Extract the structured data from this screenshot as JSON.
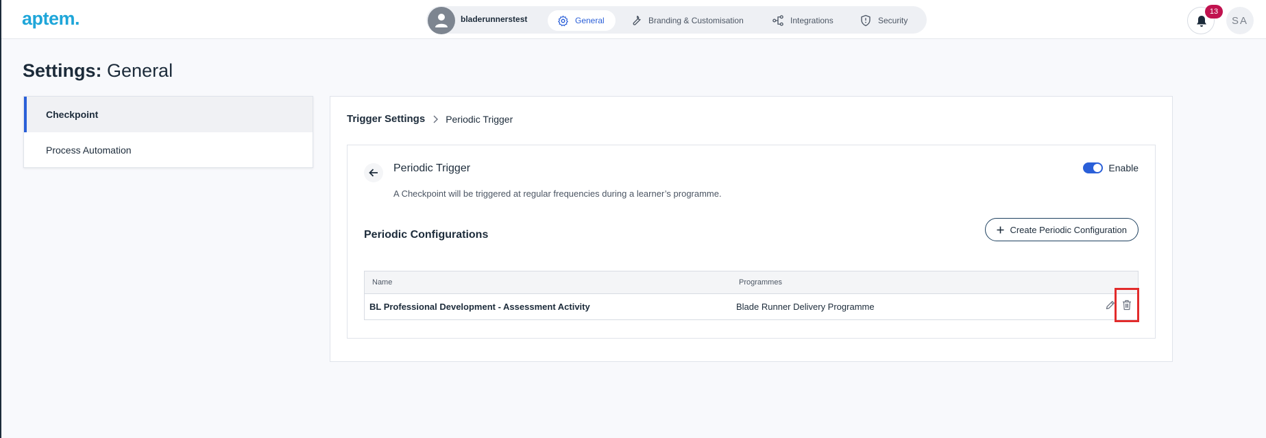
{
  "app": {
    "logo": "aptem.",
    "username": "bladerunnerstest",
    "nav_tabs": [
      {
        "label": "General",
        "icon": "gear-icon",
        "active": true
      },
      {
        "label": "Branding & Customisation",
        "icon": "wrench-icon",
        "active": false
      },
      {
        "label": "Integrations",
        "icon": "integrations-icon",
        "active": false
      },
      {
        "label": "Security",
        "icon": "shield-icon",
        "active": false
      }
    ],
    "notifications_count": "13",
    "user_initials": "SA"
  },
  "page": {
    "title_bold": "Settings:",
    "title_rest": " General"
  },
  "sidebar": {
    "items": [
      {
        "label": "Checkpoint",
        "active": true
      },
      {
        "label": "Process Automation",
        "active": false
      }
    ]
  },
  "breadcrumb": {
    "root": "Trigger Settings",
    "leaf": "Periodic Trigger"
  },
  "trigger": {
    "title": "Periodic Trigger",
    "description": "A Checkpoint will be triggered at regular frequencies during a learner’s programme.",
    "enable_label": "Enable",
    "enabled": true
  },
  "configs": {
    "title": "Periodic Configurations",
    "create_label": "Create Periodic Configuration",
    "columns": [
      "Name",
      "Programmes"
    ],
    "rows": [
      {
        "name": "BL Professional Development - Assessment Activity",
        "programmes": "Blade Runner Delivery Programme"
      }
    ]
  },
  "colors": {
    "accent": "#2a5fd8",
    "logo": "#1fa6d9",
    "badge": "#c1124f",
    "highlight": "#e22b2b"
  }
}
